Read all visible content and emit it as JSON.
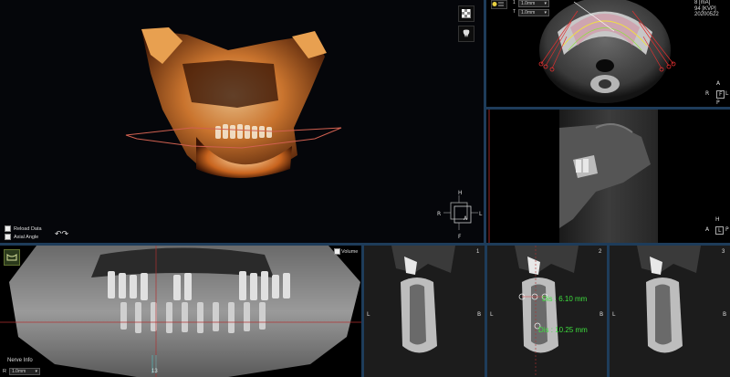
{
  "view3d": {
    "checkbox_reload": "Reload Data",
    "checkbox_axial": "Axial Angle",
    "cube_labels": {
      "top": "H",
      "left": "R",
      "right": "L",
      "front": "A",
      "bottom": "F"
    }
  },
  "axial": {
    "row1_label": "1",
    "row1_value": "1.0mm",
    "row2_label": "T",
    "row2_value": "1.0mm",
    "ma": "8 [mA]",
    "kvp": "94 [KVP]",
    "date": "20200522",
    "orient_a": "A",
    "orient_r": "R",
    "orient_f": "F",
    "orient_l": "L",
    "orient_p": "P"
  },
  "sagittal": {
    "orient_h": "H",
    "orient_a": "A",
    "orient_l": "L",
    "orient_p": "P"
  },
  "panoramic": {
    "volume_label": "Volume",
    "nerve_info": "Nerve Info",
    "nerve_r": "R",
    "nerve_value": "1.0mm",
    "slice_number": "13"
  },
  "cross_sections": [
    {
      "number": "1",
      "left": "L",
      "right": "B"
    },
    {
      "number": "2",
      "left": "L",
      "right": "B",
      "measure1": "Dis : 6.10 mm",
      "measure2": "Dis : 10.25 mm"
    },
    {
      "number": "3",
      "left": "L",
      "right": "B"
    }
  ],
  "colors": {
    "divider": "#1e3c5a",
    "measure": "#3dde3d",
    "bone": "#c8641e"
  },
  "icons": [
    "checkerboard-icon",
    "tooth-icon",
    "list-icon",
    "panorama-icon",
    "cube-icon"
  ]
}
